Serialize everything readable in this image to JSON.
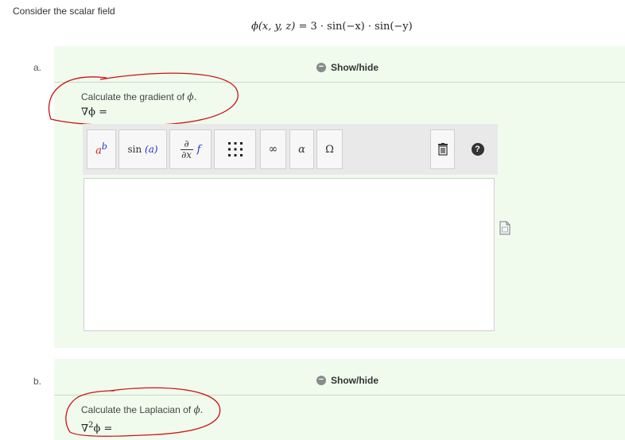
{
  "intro": "Consider the scalar field",
  "equation": {
    "lhs": "ϕ(x, y, z) = ",
    "rhs": "3 · sin(−x) · sin(−y)"
  },
  "parts": [
    {
      "letter": "a.",
      "showhide": "Show/hide",
      "toggle_symbol": "−",
      "prompt_text": "Calculate the gradient of ",
      "prompt_symbol": "ϕ.",
      "lhs": "∇ϕ ="
    },
    {
      "letter": "b.",
      "showhide": "Show/hide",
      "toggle_symbol": "−",
      "prompt_text": "Calculate the Laplacian of ",
      "prompt_symbol": "ϕ.",
      "lhs_base": "∇",
      "lhs_sup": "2",
      "lhs_rest": "ϕ ="
    }
  ],
  "toolbar": {
    "superscript": {
      "base": "a",
      "sup": "b"
    },
    "function": {
      "name": "sin",
      "arg": "(a)"
    },
    "derivative": {
      "num": "∂",
      "den": "∂x",
      "f": "f"
    },
    "infinity": "∞",
    "greek": "α",
    "upper_greek": "Ω",
    "help": "?"
  },
  "icons": [
    "matrix-icon",
    "trash-icon",
    "help-icon",
    "document-icon",
    "toggle-minus-icon"
  ],
  "colors": {
    "panel_bg": "#f0fbee",
    "annotation": "#d01010",
    "variable_blue": "#2233cc",
    "variable_red": "#cc2222"
  }
}
